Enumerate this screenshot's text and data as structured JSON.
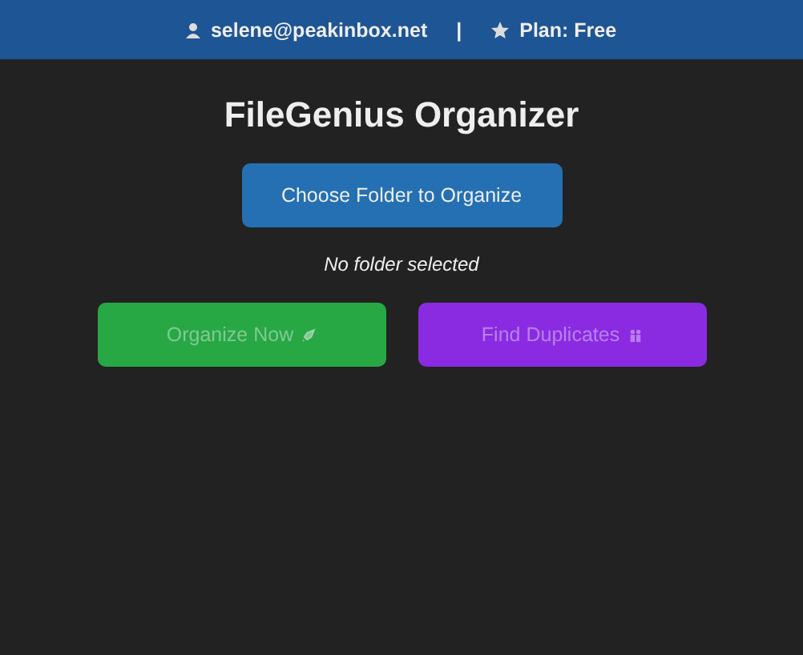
{
  "header": {
    "email": "selene@peakinbox.net",
    "separator": "|",
    "plan": "Plan: Free"
  },
  "title": "FileGenius Organizer",
  "choose_button": {
    "label": "Choose Folder to Organize"
  },
  "folder_status": "No folder selected",
  "actions": [
    {
      "label": "Organize Now",
      "kind": "organize",
      "disabled": true
    },
    {
      "label": "Find Duplicates",
      "kind": "duplicates",
      "disabled": true
    }
  ]
}
